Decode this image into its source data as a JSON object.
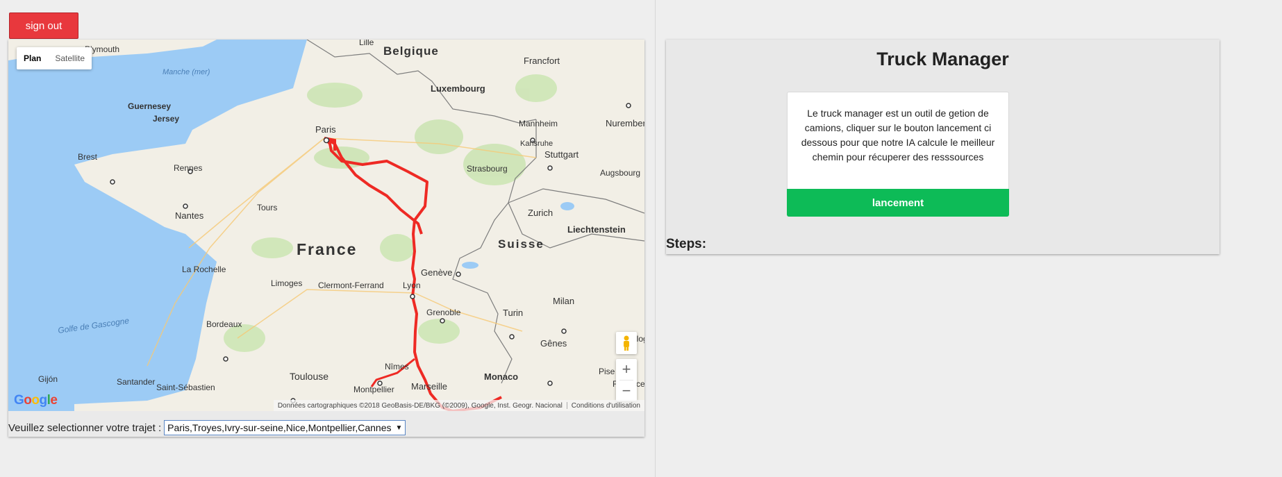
{
  "header": {
    "signout_label": "sign out"
  },
  "map": {
    "type_buttons": [
      "Plan",
      "Satellite"
    ],
    "active_type": "Plan",
    "labels": {
      "belgique": "Belgique",
      "lille": "Lille",
      "frankfort": "Francfort",
      "luxembourg": "Luxembourg",
      "plymouth": "Plymouth",
      "manche": "Manche (mer)",
      "guernesey": "Guernesey",
      "jersey": "Jersey",
      "paris": "Paris",
      "brest": "Brest",
      "rennes": "Rennes",
      "nantes": "Nantes",
      "tours": "Tours",
      "france": "France",
      "la_rochelle": "La Rochelle",
      "limoges": "Limoges",
      "clermont": "Clermont-Ferrand",
      "lyon": "Lyon",
      "geneve": "Genève",
      "grenoble": "Grenoble",
      "turin": "Turin",
      "milan": "Milan",
      "suisse": "Suisse",
      "zurich": "Zurich",
      "liechtenstein": "Liechtenstein",
      "stuttgart": "Stuttgart",
      "karlsruhe": "Karlsruhe",
      "mannheim": "Mannheim",
      "strasbourg": "Strasbourg",
      "augsbourg": "Augsbourg",
      "nuremberg": "Nuremberg",
      "bordeaux": "Bordeaux",
      "gascogne": "Golfe de Gascogne",
      "toulouse": "Toulouse",
      "gijon": "Gijón",
      "santander": "Santander",
      "saint_sebastien": "Saint-Sébastien",
      "nimes": "Nîmes",
      "montpellier": "Montpellier",
      "marseille": "Marseille",
      "monaco": "Monaco",
      "genes": "Gênes",
      "pise": "Pise",
      "florence": "Florence",
      "bologne": "Bolog"
    },
    "attribution": "Données cartographiques ©2018 GeoBasis-DE/BKG (©2009), Google, Inst. Geogr. Nacional",
    "terms": "Conditions d'utilisation",
    "google_logo": "Google",
    "zoom_in": "+",
    "zoom_out": "−"
  },
  "route": {
    "label": "Veuillez selectionner votre trajet :",
    "selected": "Paris,Troyes,Ivry-sur-seine,Nice,Montpellier,Cannes"
  },
  "truck_manager": {
    "title": "Truck Manager",
    "description": "Le truck manager est un outil de getion de camions, cliquer sur le bouton lancement ci dessous pour que notre IA calcule le meilleur chemin pour récuperer des resssources",
    "launch_label": "lancement",
    "steps_label": "Steps:"
  },
  "colors": {
    "signout": "#e8383d",
    "launch": "#0dbb57",
    "route": "#ee2a24",
    "water": "#9ccbf5"
  }
}
